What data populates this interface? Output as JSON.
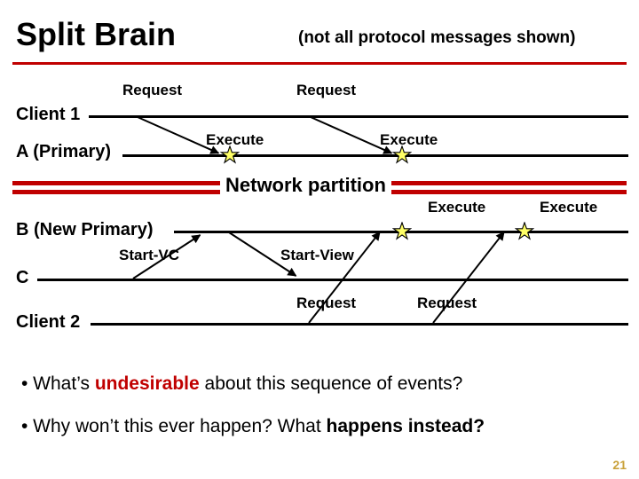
{
  "title": "Split Brain",
  "subtitle": "(not all protocol messages shown)",
  "actors": {
    "client1": "Client 1",
    "aPrimary": "A (Primary)",
    "bNewPrimary": "B  (New Primary)",
    "c": "C",
    "client2": "Client 2"
  },
  "labels": {
    "request": "Request",
    "execute": "Execute",
    "startVC": "Start-VC",
    "startView": "Start-View",
    "networkPartition": "Network partition"
  },
  "bullets": {
    "b1_pre": "•  What’s ",
    "b1_red": "undesirable",
    "b1_post": " about this sequence of events?",
    "b2_pre": "•  Why won’t this ever happen?  What ",
    "b2_bold": "happens instead?",
    "b2_post": ""
  },
  "pagenum": "21",
  "chart_data": {
    "type": "sequence-diagram",
    "actors": [
      "Client 1",
      "A (Primary)",
      "B (New Primary)",
      "C",
      "Client 2"
    ],
    "events": [
      {
        "from": "Client 1",
        "to": "A (Primary)",
        "label": "Request"
      },
      {
        "at": "A (Primary)",
        "label": "Execute"
      },
      {
        "from": "Client 1",
        "to": "A (Primary)",
        "label": "Request"
      },
      {
        "at": "A (Primary)",
        "label": "Execute"
      },
      {
        "divider": "Network partition"
      },
      {
        "from": "C",
        "to": "B (New Primary)",
        "label": "Start-VC"
      },
      {
        "from": "B (New Primary)",
        "to": "C",
        "label": "Start-View"
      },
      {
        "from": "Client 2",
        "to": "B (New Primary)",
        "label": "Request"
      },
      {
        "at": "B (New Primary)",
        "label": "Execute"
      },
      {
        "from": "Client 2",
        "to": "B (New Primary)",
        "label": "Request"
      },
      {
        "at": "B (New Primary)",
        "label": "Execute"
      }
    ]
  }
}
